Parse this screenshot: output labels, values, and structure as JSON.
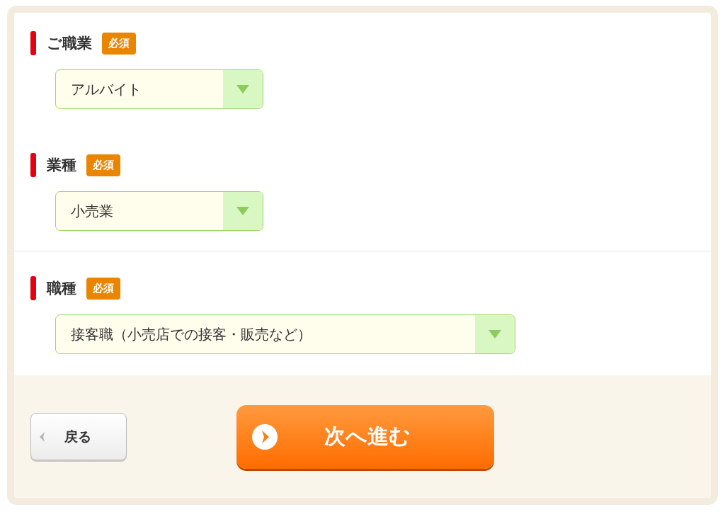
{
  "sections": [
    {
      "fields": [
        {
          "label": "ご職業",
          "badge": "必須",
          "value": "アルバイト",
          "wide": false
        },
        {
          "label": "業種",
          "badge": "必須",
          "value": "小売業",
          "wide": false
        }
      ]
    },
    {
      "fields": [
        {
          "label": "職種",
          "badge": "必須",
          "value": "接客職（小売店での接客・販売など）",
          "wide": true
        }
      ]
    }
  ],
  "buttons": [
    {
      "kind": "back",
      "label": "戻る"
    },
    {
      "kind": "next",
      "label": "次へ進む"
    }
  ]
}
